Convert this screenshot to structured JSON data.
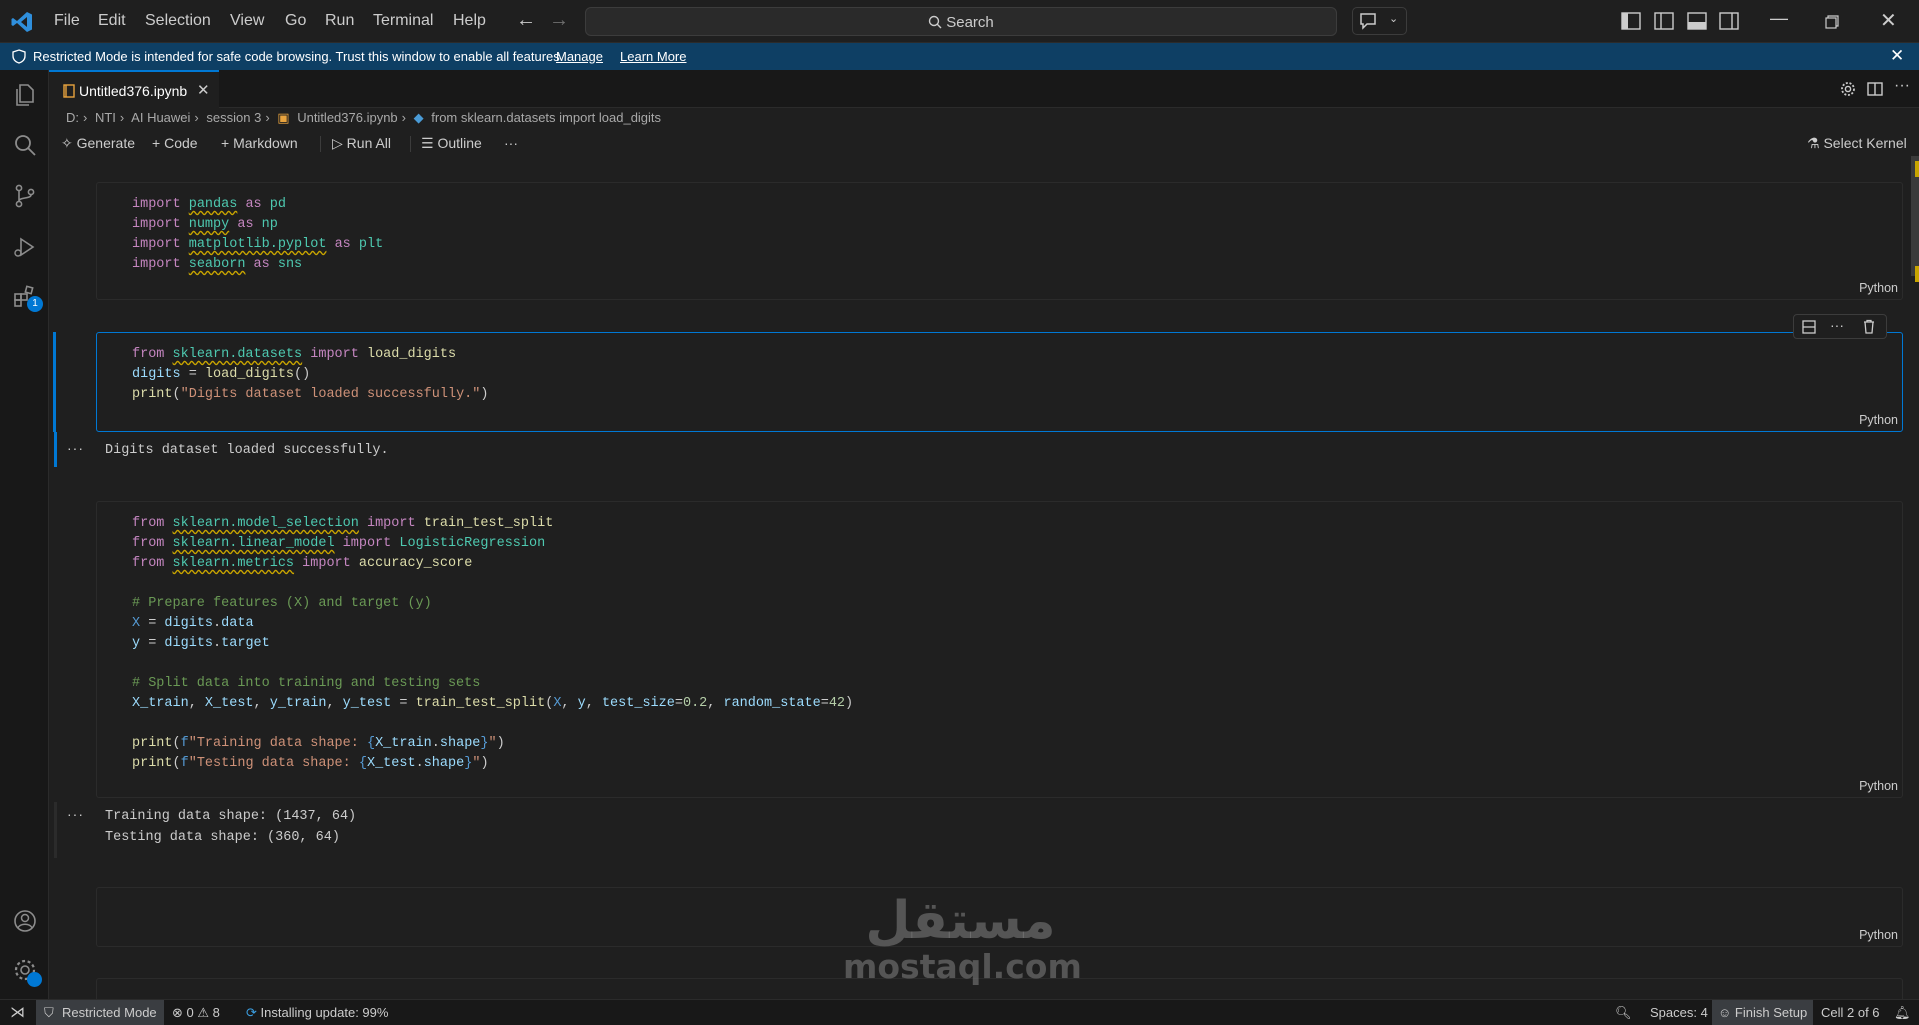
{
  "titlebar": {
    "menu": [
      "File",
      "Edit",
      "Selection",
      "View",
      "Go",
      "Run",
      "Terminal",
      "Help"
    ],
    "search_label": "Search"
  },
  "banner": {
    "message": "Restricted Mode is intended for safe code browsing. Trust this window to enable all features.",
    "manage": "Manage",
    "learn_more": "Learn More"
  },
  "activity": {
    "extensions_badge": "1"
  },
  "tab": {
    "title": "Untitled376.ipynb"
  },
  "breadcrumb": [
    "D:",
    "NTI",
    "AI Huawei",
    "session 3",
    "Untitled376.ipynb",
    "from sklearn.datasets import load_digits"
  ],
  "toolbar": {
    "generate": "Generate",
    "code": "Code",
    "markdown": "Markdown",
    "run_all": "Run All",
    "outline": "Outline",
    "more": "···",
    "select_kernel": "Select Kernel"
  },
  "cells": {
    "language": "Python",
    "cell1": [
      "import pandas as pd",
      "import numpy as np",
      "import matplotlib.pyplot as plt",
      "import seaborn as sns"
    ],
    "cell2": [
      "from sklearn.datasets import load_digits",
      "digits = load_digits()",
      "print(\"Digits dataset loaded successfully.\")"
    ],
    "cell2_output": "Digits dataset loaded successfully.",
    "cell3": [
      "from sklearn.model_selection import train_test_split",
      "from sklearn.linear_model import LogisticRegression",
      "from sklearn.metrics import accuracy_score",
      "",
      "# Prepare features (X) and target (y)",
      "X = digits.data",
      "y = digits.target",
      "",
      "# Split data into training and testing sets",
      "X_train, X_test, y_train, y_test = train_test_split(X, y, test_size=0.2, random_state=42)",
      "",
      "print(f\"Training data shape: {X_train.shape}\")",
      "print(f\"Testing data shape: {X_test.shape}\")"
    ],
    "cell3_output": [
      "Training data shape: (1437, 64)",
      "Testing data shape: (360, 64)"
    ]
  },
  "statusbar": {
    "restricted": "Restricted Mode",
    "errors": "0",
    "warnings": "8",
    "installing": "Installing update: 99%",
    "spaces": "Spaces: 4",
    "finish_setup": "Finish Setup",
    "cell_pos": "Cell 2 of 6"
  },
  "watermark": {
    "arabic": "مستقل",
    "latin": "mostaql.com"
  },
  "colors": {
    "accent": "#0078d4",
    "banner": "#0e3f64",
    "background": "#1f1f1f"
  }
}
